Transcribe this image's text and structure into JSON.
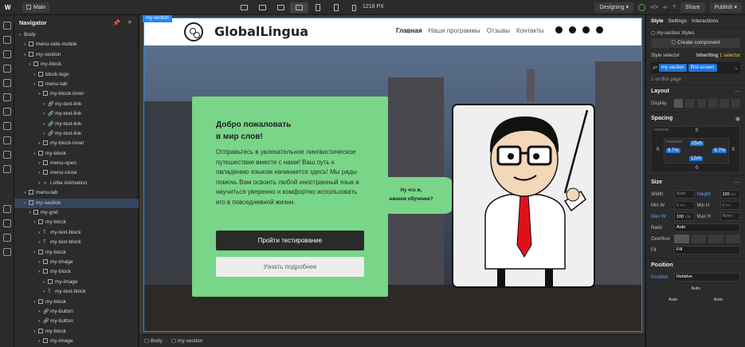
{
  "topbar": {
    "page_label": "Main",
    "canvas_size": "1218 PX",
    "mode": "Designing",
    "share": "Share",
    "publish": "Publish"
  },
  "navigator": {
    "title": "Navigator",
    "items": [
      {
        "label": "Body",
        "depth": 0,
        "type": "body"
      },
      {
        "label": "menu-side-mobile",
        "depth": 1,
        "type": "box"
      },
      {
        "label": "my-section",
        "depth": 1,
        "type": "box"
      },
      {
        "label": "my-block",
        "depth": 2,
        "type": "box"
      },
      {
        "label": "block-logo",
        "depth": 3,
        "type": "box"
      },
      {
        "label": "menu-tab",
        "depth": 3,
        "type": "box"
      },
      {
        "label": "my-block-inner",
        "depth": 4,
        "type": "box"
      },
      {
        "label": "my-text-link",
        "depth": 5,
        "type": "link"
      },
      {
        "label": "my-text-link",
        "depth": 5,
        "type": "link"
      },
      {
        "label": "my-text-link",
        "depth": 5,
        "type": "link"
      },
      {
        "label": "my-text-link",
        "depth": 5,
        "type": "link"
      },
      {
        "label": "my-block-inner",
        "depth": 4,
        "type": "box"
      },
      {
        "label": "my-block",
        "depth": 3,
        "type": "box"
      },
      {
        "label": "menu-open",
        "depth": 4,
        "type": "box"
      },
      {
        "label": "menu-close",
        "depth": 4,
        "type": "box"
      },
      {
        "label": "Lottie Animation",
        "depth": 4,
        "type": "lottie"
      },
      {
        "label": "menu-tab",
        "depth": 1,
        "type": "box"
      },
      {
        "label": "my-section",
        "depth": 1,
        "type": "box",
        "selected": true
      },
      {
        "label": "my-grid",
        "depth": 2,
        "type": "grid"
      },
      {
        "label": "my-block",
        "depth": 3,
        "type": "box"
      },
      {
        "label": "my-text-block",
        "depth": 4,
        "type": "text"
      },
      {
        "label": "my-text-block",
        "depth": 4,
        "type": "text"
      },
      {
        "label": "my-block",
        "depth": 3,
        "type": "box"
      },
      {
        "label": "my-image",
        "depth": 4,
        "type": "image"
      },
      {
        "label": "my-block",
        "depth": 4,
        "type": "box"
      },
      {
        "label": "my-image",
        "depth": 5,
        "type": "image"
      },
      {
        "label": "my-text-block",
        "depth": 5,
        "type": "text"
      },
      {
        "label": "my-block",
        "depth": 3,
        "type": "box"
      },
      {
        "label": "my-button",
        "depth": 4,
        "type": "link"
      },
      {
        "label": "my-button",
        "depth": 4,
        "type": "link"
      },
      {
        "label": "my-block",
        "depth": 3,
        "type": "box"
      },
      {
        "label": "my-image",
        "depth": 4,
        "type": "image"
      }
    ]
  },
  "canvas": {
    "section_tag": "my-section",
    "site": {
      "brand": "GlobalLingua",
      "nav": [
        "Главная",
        "Наши программы",
        "Отзывы",
        "Контакты"
      ],
      "social_icons": [
        "telegram-icon",
        "facebook-icon",
        "twitter-icon",
        "vk-icon"
      ]
    },
    "card": {
      "heading_line1": "Добро пожаловать",
      "heading_line2": "в мир слов!",
      "body": "Отправьтесь в увлекательное лингвистическое путешествие вместе с нами! Ваш путь к овладению языком начинается здесь! Мы рады помочь Вам освоить любой иностранный язык и научиться уверенно и комфортно использовать его в повседневной жизни.",
      "primary_button": "Пройти тестирование",
      "secondary_button": "Узнать подробнее",
      "accent_color": "#79d588"
    },
    "bubble": {
      "line1": "Ну что ж,",
      "line2": "начнем обучение?"
    }
  },
  "breadcrumb": [
    "Body",
    "my-section"
  ],
  "style_panel": {
    "tabs": [
      "Style",
      "Settings",
      "Interactions"
    ],
    "selection_label": "my-section Styles",
    "create_component": "Create component",
    "style_selector_label": "Style selector",
    "inheriting_prefix": "Inheriting",
    "inheriting_count": "1 selector",
    "chips": [
      "my-section",
      "first-screen"
    ],
    "on_page": "1 on this page",
    "layout": {
      "title": "Layout",
      "display_label": "Display"
    },
    "spacing": {
      "title": "Spacing",
      "margin_label": "MARGIN",
      "padding_label": "PADDING",
      "margin": {
        "top": "0",
        "right": "0",
        "bottom": "0",
        "left": "0"
      },
      "padding": {
        "top": "25vh",
        "right": "9.7%",
        "bottom": "12vh",
        "left": "9.7%"
      }
    },
    "size": {
      "title": "Size",
      "width_label": "Width",
      "width_val": "Auto",
      "height_label": "Height",
      "height_val": "100",
      "height_unit": "VH",
      "minw_label": "Min W",
      "minw_val": "0",
      "minw_unit": "PX",
      "minh_label": "Min H",
      "minh_val": "0",
      "minh_unit": "PX",
      "maxw_label": "Max W",
      "maxw_val": "100",
      "maxw_unit": "VW",
      "maxh_label": "Max H",
      "maxh_val": "None"
    },
    "ratio": {
      "label": "Ratio",
      "val": "Auto"
    },
    "overflow": {
      "label": "Overflow"
    },
    "fit": {
      "label": "Fit",
      "val": "Fill"
    },
    "position": {
      "title": "Position",
      "label": "Position",
      "val": "Relative",
      "auto": "Auto"
    }
  }
}
